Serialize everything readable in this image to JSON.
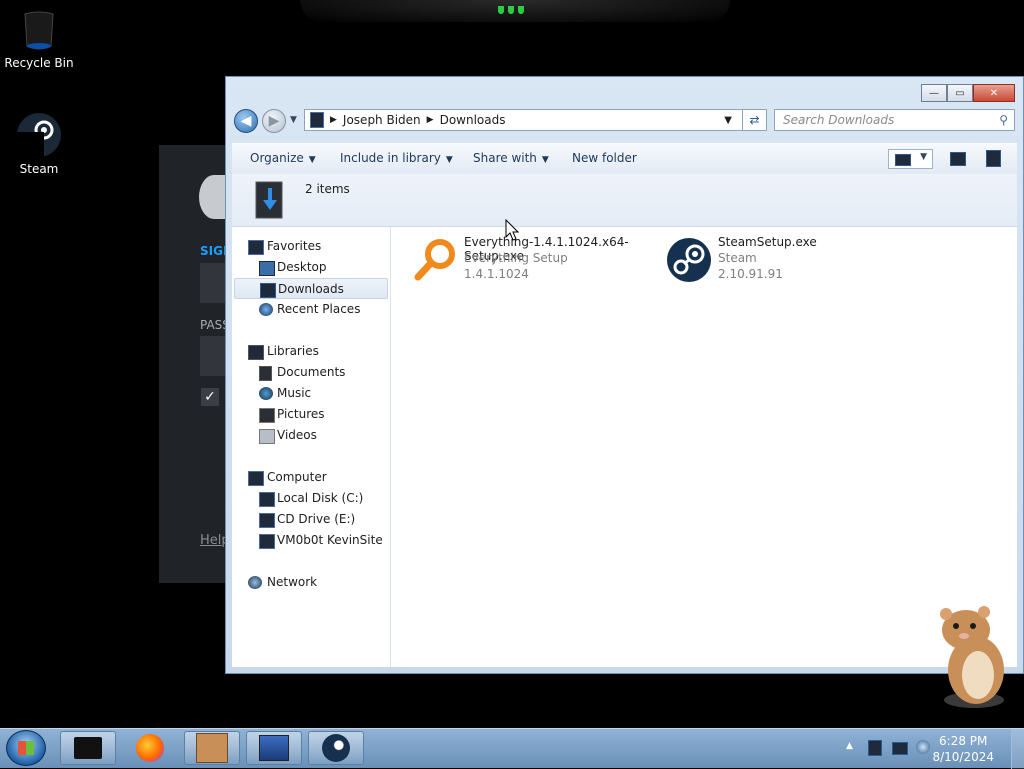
{
  "desktop": {
    "icons": [
      {
        "label": "Recycle Bin",
        "icon": "recycle-bin-icon"
      },
      {
        "label": "Steam",
        "icon": "steam-icon"
      }
    ]
  },
  "steam_login": {
    "sign_label": "SIGN",
    "pass_label": "PASS",
    "checkbox": "✓",
    "help": "Help"
  },
  "window": {
    "controls": {
      "minimize": "—",
      "maximize": "▭",
      "close": "✕"
    },
    "breadcrumb": [
      "Joseph Biden",
      "Downloads"
    ],
    "search_placeholder": "Search Downloads",
    "toolbar": {
      "organize": "Organize",
      "include": "Include in library",
      "share": "Share with",
      "new_folder": "New folder"
    },
    "item_count": "2 items",
    "nav": {
      "favorites": "Favorites",
      "desktop": "Desktop",
      "downloads": "Downloads",
      "recent": "Recent Places",
      "libraries": "Libraries",
      "documents": "Documents",
      "music": "Music",
      "pictures": "Pictures",
      "videos": "Videos",
      "computer": "Computer",
      "local_disk": "Local Disk (C:)",
      "cd_drive": "CD Drive (E:)",
      "vmshare": "VM0b0t KevinSite",
      "network": "Network"
    },
    "files": [
      {
        "name": "Everything-1.4.1.1024.x64-Setup.exe",
        "description": "Everything Setup",
        "version": "1.4.1.1024"
      },
      {
        "name": "SteamSetup.exe",
        "description": "Steam",
        "version": "2.10.91.91"
      }
    ]
  },
  "taskbar": {
    "time": "6:28 PM",
    "date": "8/10/2024",
    "tray_arrow": "▲"
  },
  "colors": {
    "accent": "#2e6fb4",
    "steam_blue": "#1a9fff",
    "everything_orange": "#f08a1c"
  }
}
